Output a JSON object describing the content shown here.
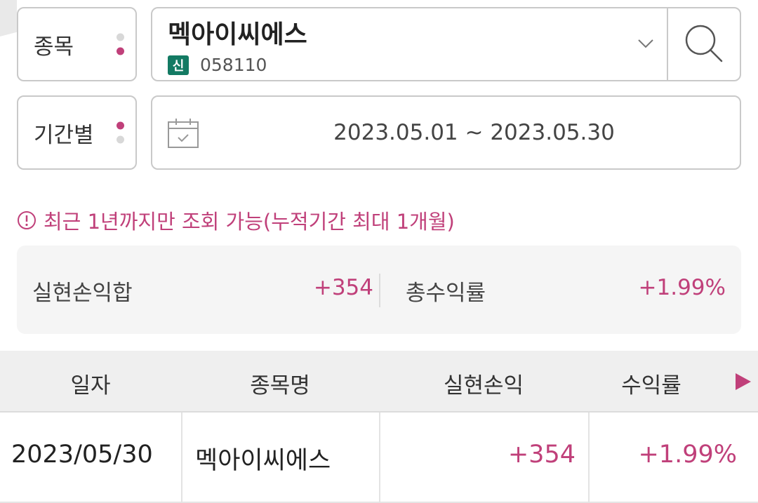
{
  "filters": {
    "stock_label": "종목",
    "period_label": "기간별",
    "stock_name": "멕아이씨에스",
    "stock_badge": "신",
    "stock_code": "058110",
    "date_range": "2023.05.01 ~ 2023.05.30"
  },
  "notice": "최근 1년까지만 조회 가능(누적기간 최대 1개월)",
  "summary": {
    "realized_label": "실현손익합",
    "realized_value": "+354",
    "return_label": "총수익률",
    "return_value": "+1.99%"
  },
  "table": {
    "headers": [
      "일자",
      "종목명",
      "실현손익",
      "수익률"
    ],
    "rows": [
      [
        "2023/05/30",
        "멕아이씨에스",
        "+354",
        "+1.99%"
      ]
    ]
  },
  "colors": {
    "accent": "#c0407a",
    "badge": "#137a63",
    "border": "#c9c9c9"
  },
  "icons": [
    "chevron-down-icon",
    "search-icon",
    "calendar-icon",
    "info-icon",
    "next-arrow-icon"
  ]
}
